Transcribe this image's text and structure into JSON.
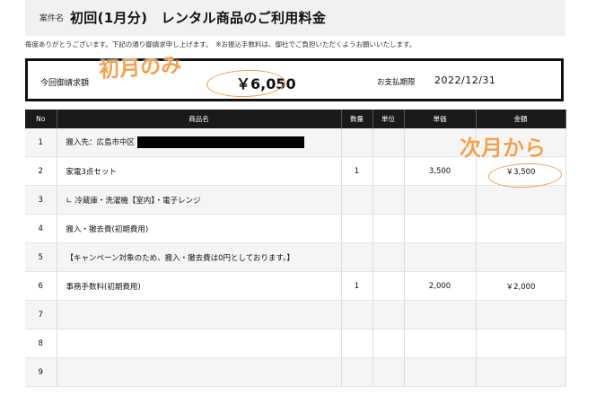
{
  "header": {
    "case_label": "案件名",
    "title": "初回(1月分)　レンタル商品のご利用料金"
  },
  "note": "毎度ありがとうございます。下記の通り御請求申し上げます。　※お振込手数料は、御社でご負担いただくようお願いいたします。",
  "billing": {
    "label": "今回御請求額",
    "amount": "￥6,050",
    "due_label": "お支払期限",
    "due_date": "2022/12/31"
  },
  "annotations": {
    "first_month_only": "初月のみ",
    "from_next_month": "次月から"
  },
  "colors": {
    "annotation": "#f7a04f",
    "table_header": "#1a1a1a"
  },
  "table": {
    "headers": {
      "no": "No",
      "name": "商品名",
      "qty": "数量",
      "unit": "単位",
      "price": "単価",
      "amount": "金額"
    },
    "rows": [
      {
        "no": "1",
        "name": "搬入先：広島市中区",
        "qty": "",
        "unit": "",
        "price": "",
        "amount": ""
      },
      {
        "no": "2",
        "name": "家電3点セット",
        "qty": "1",
        "unit": "",
        "price": "3,500",
        "amount": "￥3,500"
      },
      {
        "no": "3",
        "name": "∟ 冷蔵庫・洗濯機【室内】・電子レンジ",
        "qty": "",
        "unit": "",
        "price": "",
        "amount": ""
      },
      {
        "no": "4",
        "name": "搬入・撤去費(初期費用)",
        "qty": "",
        "unit": "",
        "price": "",
        "amount": ""
      },
      {
        "no": "5",
        "name": "【キャンペーン対象のため、搬入・撤去費は0円としております。】",
        "qty": "",
        "unit": "",
        "price": "",
        "amount": ""
      },
      {
        "no": "6",
        "name": "事務手数料(初期費用)",
        "qty": "1",
        "unit": "",
        "price": "2,000",
        "amount": "￥2,000"
      },
      {
        "no": "7",
        "name": "",
        "qty": "",
        "unit": "",
        "price": "",
        "amount": ""
      },
      {
        "no": "8",
        "name": "",
        "qty": "",
        "unit": "",
        "price": "",
        "amount": ""
      },
      {
        "no": "9",
        "name": "",
        "qty": "",
        "unit": "",
        "price": "",
        "amount": ""
      }
    ]
  }
}
